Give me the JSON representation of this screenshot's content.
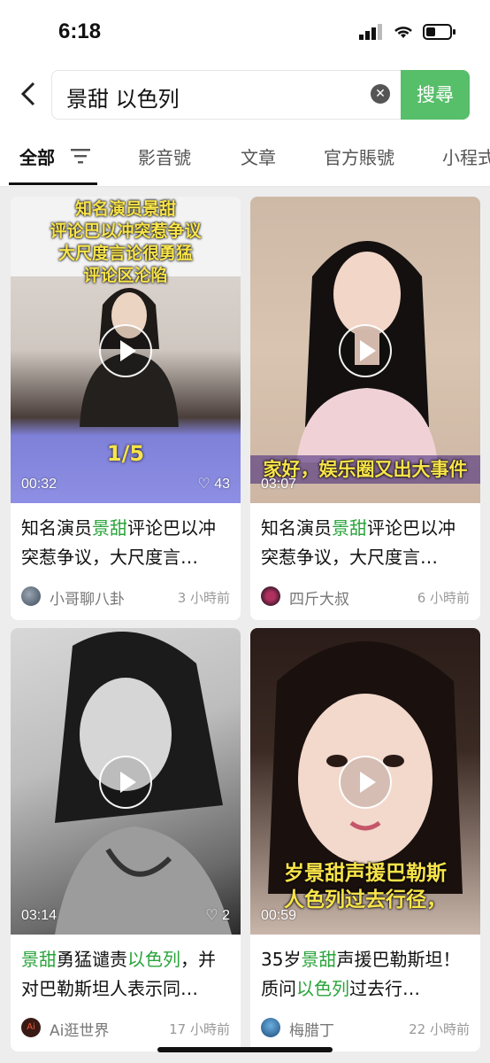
{
  "status": {
    "time": "6:18"
  },
  "search": {
    "query": "景甜 以色列",
    "button": "搜尋"
  },
  "tabs": [
    "全部",
    "影音號",
    "文章",
    "官方賬號",
    "小程式"
  ],
  "cards": [
    {
      "duration": "00:32",
      "likes": "43",
      "caption": [
        "知名演员景甜",
        "评论巴以冲突惹争议",
        "大尺度言论很勇猛",
        "评论区沦陷"
      ],
      "page": "1/5",
      "title": [
        {
          "t": "知名演员"
        },
        {
          "t": "景甜",
          "hl": true
        },
        {
          "t": "评论巴以冲突惹争议，大尺度言…"
        }
      ],
      "author": "小哥聊八卦",
      "ago": "3 小時前"
    },
    {
      "duration": "03:07",
      "likes": "",
      "caption": [
        "家好，娱乐圈又出大事件"
      ],
      "title": [
        {
          "t": "知名演员"
        },
        {
          "t": "景甜",
          "hl": true
        },
        {
          "t": "评论巴以冲突惹争议，大尺度言…"
        }
      ],
      "author": "四斤大叔",
      "ago": "6 小時前"
    },
    {
      "duration": "03:14",
      "likes": "2",
      "caption": [],
      "title": [
        {
          "t": "景甜",
          "hl": true
        },
        {
          "t": "勇猛谴责"
        },
        {
          "t": "以色列",
          "hl": true
        },
        {
          "t": "，并对巴勒斯坦人表示同…"
        }
      ],
      "author": "Ai逛世界",
      "ago": "17 小時前"
    },
    {
      "duration": "00:59",
      "likes": "",
      "caption": [
        "岁景甜声援巴勒斯",
        "人色列过去行径，"
      ],
      "title": [
        {
          "t": "35岁"
        },
        {
          "t": "景甜",
          "hl": true
        },
        {
          "t": "声援巴勒斯坦！质问"
        },
        {
          "t": "以色列",
          "hl": true
        },
        {
          "t": "过去行…"
        }
      ],
      "author": "梅腊丁",
      "ago": "22 小時前"
    }
  ],
  "colors": {
    "accent": "#57be6a",
    "highlight": "#2aa43b"
  },
  "icons": [
    "back-icon",
    "clear-icon",
    "filter-icon",
    "play-icon",
    "heart-icon",
    "signal-icon",
    "wifi-icon",
    "battery-icon"
  ]
}
